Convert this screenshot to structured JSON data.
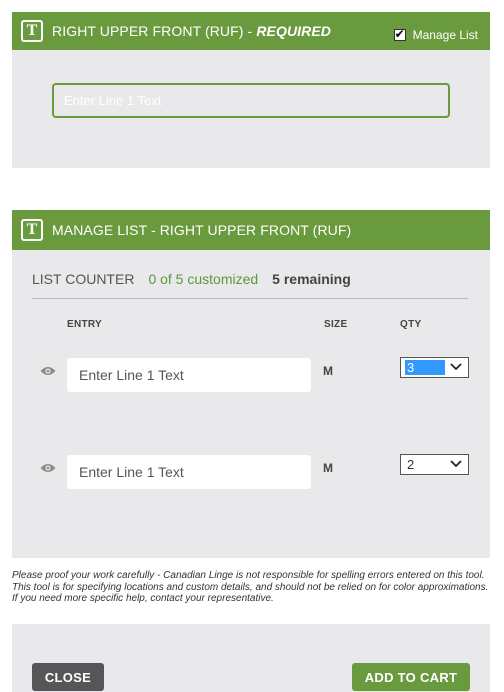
{
  "section1": {
    "title": "RIGHT UPPER FRONT (RUF) - ",
    "required": "REQUIRED",
    "manage_list_label": "Manage List",
    "manage_list_checked": true,
    "line1_placeholder": "Enter Line 1 Text"
  },
  "section2": {
    "title": "MANAGE LIST - RIGHT UPPER FRONT (RUF)",
    "counter_label": "LIST COUNTER",
    "counter_customized": "0 of 5 customized",
    "counter_remaining": "5 remaining",
    "columns": {
      "entry": "ENTRY",
      "size": "SIZE",
      "qty": "QTY"
    },
    "rows": [
      {
        "placeholder": "Enter Line 1 Text",
        "size": "M",
        "qty": "3"
      },
      {
        "placeholder": "Enter Line 1 Text",
        "size": "M",
        "qty": "2"
      }
    ]
  },
  "disclaimer": "Please proof your work carefully - Canadian Linge is not responsible for spelling errors entered on this tool. This tool is for specifying locations and custom details, and should not be relied on for color approximations. If you need more specific help, contact your representative.",
  "footer": {
    "close_label": "CLOSE",
    "add_to_cart_label": "ADD TO CART"
  },
  "colors": {
    "accent": "#6a9a3e",
    "panel_bg": "#e9e8ea",
    "close_btn": "#555658"
  }
}
